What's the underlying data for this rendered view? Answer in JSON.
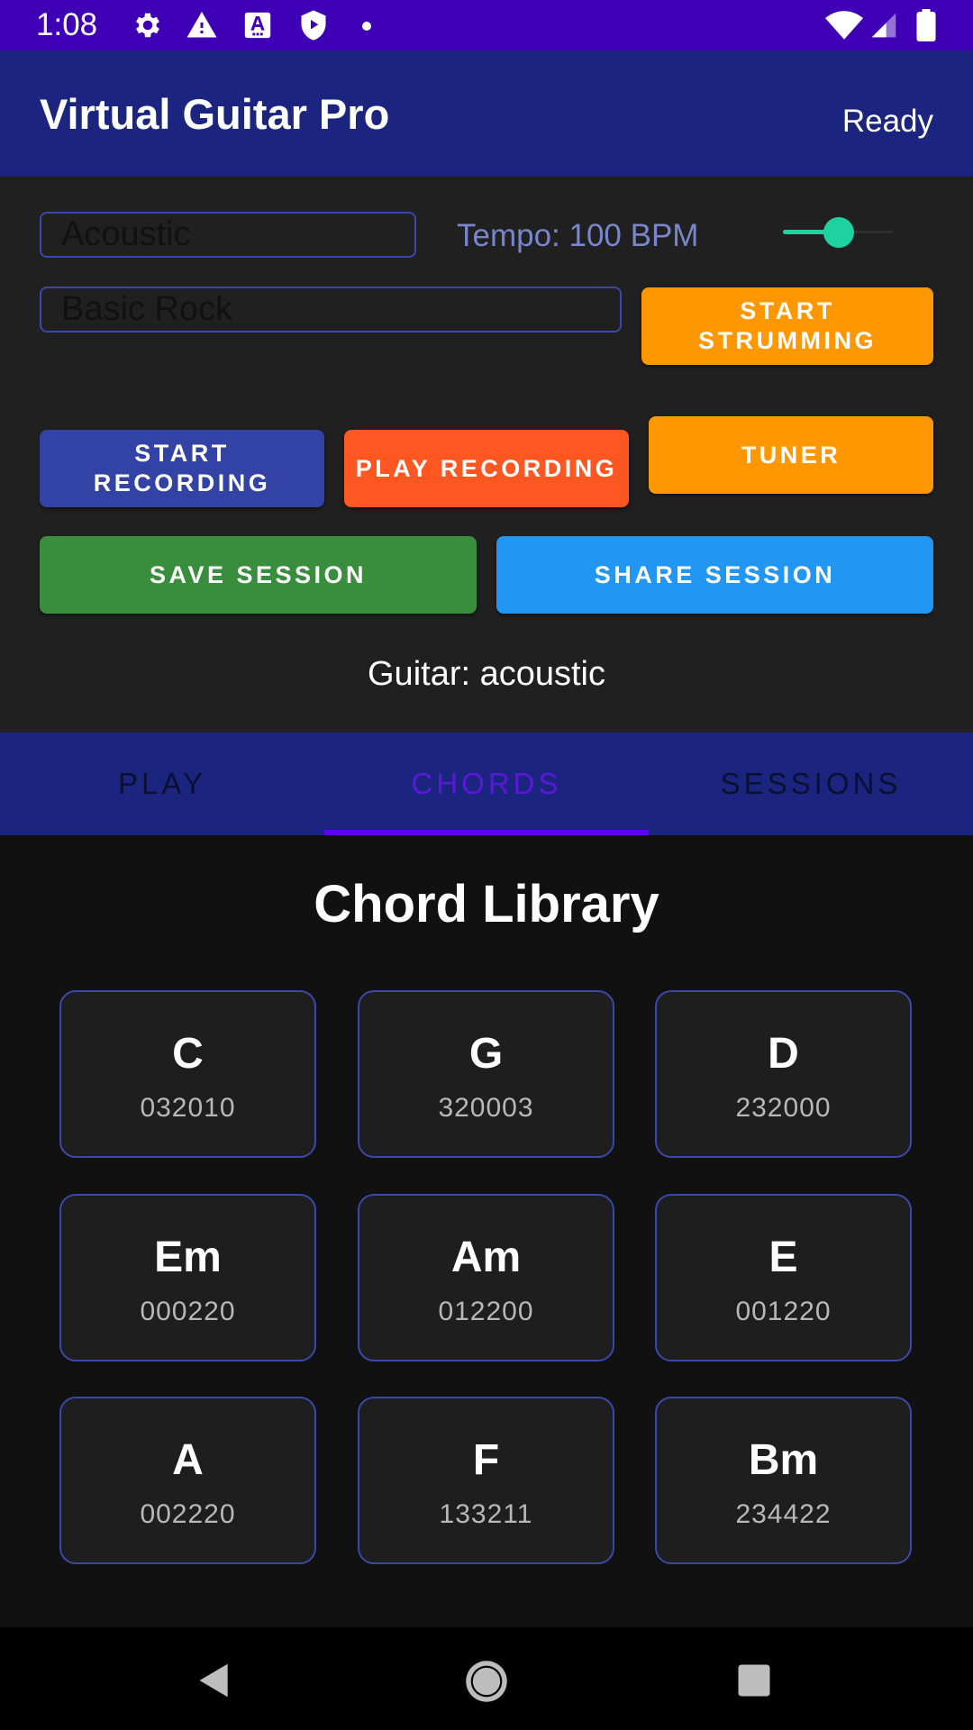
{
  "status_bar": {
    "time": "1:08",
    "left_icons": [
      "gear-icon",
      "warning-icon",
      "text-a-icon",
      "shield-play-icon",
      "dot-icon"
    ],
    "right_icons": [
      "wifi-icon",
      "signal-icon",
      "battery-icon"
    ]
  },
  "app_bar": {
    "title": "Virtual Guitar Pro",
    "status": "Ready"
  },
  "controls": {
    "guitar_type_value": "Acoustic",
    "tempo_label": "Tempo: 100 BPM",
    "tempo_slider_fraction": 0.45,
    "pattern_value": "Basic Rock",
    "start_strumming": "START STRUMMING",
    "start_recording": "START RECORDING",
    "play_recording": "PLAY RECORDING",
    "tuner": "TUNER",
    "save_session": "SAVE SESSION",
    "share_session": "SHARE SESSION",
    "guitar_label": "Guitar: acoustic"
  },
  "colors": {
    "status_bar": "#3f00b5",
    "app_bar": "#1b2580",
    "accent_teal": "#1dd1a1",
    "orange": "#ff9800",
    "deep_orange": "#ff5722",
    "indigo": "#3949ab",
    "green": "#388e3c",
    "blue": "#2196f3",
    "tab_indicator": "#6200ee"
  },
  "tabs": [
    {
      "label": "PLAY",
      "active": false
    },
    {
      "label": "CHORDS",
      "active": true
    },
    {
      "label": "SESSIONS",
      "active": false
    }
  ],
  "chord_library": {
    "title": "Chord Library",
    "chords": [
      {
        "name": "C",
        "frets": "032010"
      },
      {
        "name": "G",
        "frets": "320003"
      },
      {
        "name": "D",
        "frets": "232000"
      },
      {
        "name": "Em",
        "frets": "000220"
      },
      {
        "name": "Am",
        "frets": "012200"
      },
      {
        "name": "E",
        "frets": "001220"
      },
      {
        "name": "A",
        "frets": "002220"
      },
      {
        "name": "F",
        "frets": "133211"
      },
      {
        "name": "Bm",
        "frets": "234422"
      }
    ]
  },
  "nav_bar": {
    "icons": [
      "back-icon",
      "home-icon",
      "recents-icon"
    ]
  }
}
